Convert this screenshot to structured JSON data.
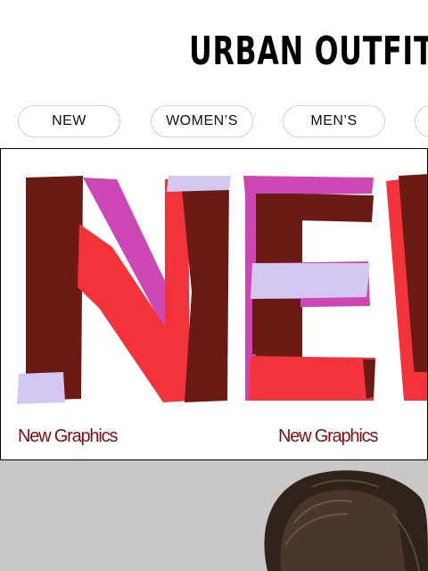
{
  "header": {
    "brand": "URBAN OUTFITTERS"
  },
  "nav": {
    "items": [
      {
        "label": "NEW"
      },
      {
        "label": "WOMEN’S"
      },
      {
        "label": "MEN’S"
      },
      {
        "label": ""
      }
    ]
  },
  "banner": {
    "captions": [
      "New Graphics",
      "New Graphics"
    ],
    "colors": {
      "maroon": "#6b1a14",
      "red": "#f2333a",
      "magenta": "#cc46b5",
      "lavender": "#d2c8f2",
      "caption": "#7a1016"
    }
  }
}
